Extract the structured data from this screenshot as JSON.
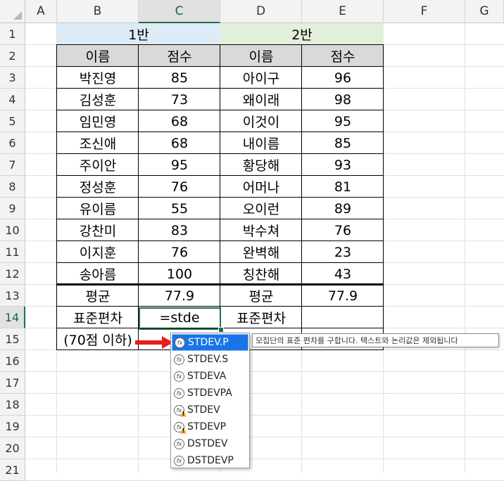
{
  "columns": [
    "A",
    "B",
    "C",
    "D",
    "E",
    "F",
    "G"
  ],
  "rows": [
    "1",
    "2",
    "3",
    "4",
    "5",
    "6",
    "7",
    "8",
    "9",
    "10",
    "11",
    "12",
    "13",
    "14",
    "15",
    "16",
    "17",
    "18",
    "19",
    "20",
    "21"
  ],
  "group1_label": "1반",
  "group2_label": "2반",
  "headers": {
    "name": "이름",
    "score": "점수"
  },
  "colors": {
    "group1_fill": "#ddebf7",
    "group2_fill": "#e2efda",
    "header_fill": "#d9d9d9",
    "accent": "#1e7145",
    "arrow": "#e81c1c",
    "dropdown_selected": "#1a73e8"
  },
  "class1": [
    {
      "name": "박진영",
      "score": "85"
    },
    {
      "name": "김성훈",
      "score": "73"
    },
    {
      "name": "임민영",
      "score": "68"
    },
    {
      "name": "조신애",
      "score": "68"
    },
    {
      "name": "주이안",
      "score": "95"
    },
    {
      "name": "정성훈",
      "score": "76"
    },
    {
      "name": "유이름",
      "score": "55"
    },
    {
      "name": "강찬미",
      "score": "83"
    },
    {
      "name": "이지훈",
      "score": "76"
    },
    {
      "name": "송아름",
      "score": "100"
    }
  ],
  "class2": [
    {
      "name": "아이구",
      "score": "96"
    },
    {
      "name": "왜이래",
      "score": "98"
    },
    {
      "name": "이것이",
      "score": "95"
    },
    {
      "name": "내이름",
      "score": "85"
    },
    {
      "name": "황당해",
      "score": "93"
    },
    {
      "name": "어머나",
      "score": "81"
    },
    {
      "name": "오이런",
      "score": "89"
    },
    {
      "name": "박수쳐",
      "score": "76"
    },
    {
      "name": "완벽해",
      "score": "23"
    },
    {
      "name": "칭찬해",
      "score": "43"
    }
  ],
  "summary": {
    "avg_label": "평균",
    "avg1": "77.9",
    "avg2": "77.9",
    "std_label": "표준편차",
    "std_formula": "=stde",
    "note": "(70점 이하)"
  },
  "autocomplete": [
    {
      "name": "STDEV.P",
      "icon": "function-icon",
      "selected": true
    },
    {
      "name": "STDEV.S",
      "icon": "function-icon"
    },
    {
      "name": "STDEVA",
      "icon": "function-icon"
    },
    {
      "name": "STDEVPA",
      "icon": "function-icon"
    },
    {
      "name": "STDEV",
      "icon": "compat-function-icon"
    },
    {
      "name": "STDEVP",
      "icon": "compat-function-icon"
    },
    {
      "name": "DSTDEV",
      "icon": "function-icon"
    },
    {
      "name": "DSTDEVP",
      "icon": "function-icon"
    }
  ],
  "tooltip": "모집단의 표준 편차를 구합니다. 텍스트와 논리값은 제외됩니다"
}
